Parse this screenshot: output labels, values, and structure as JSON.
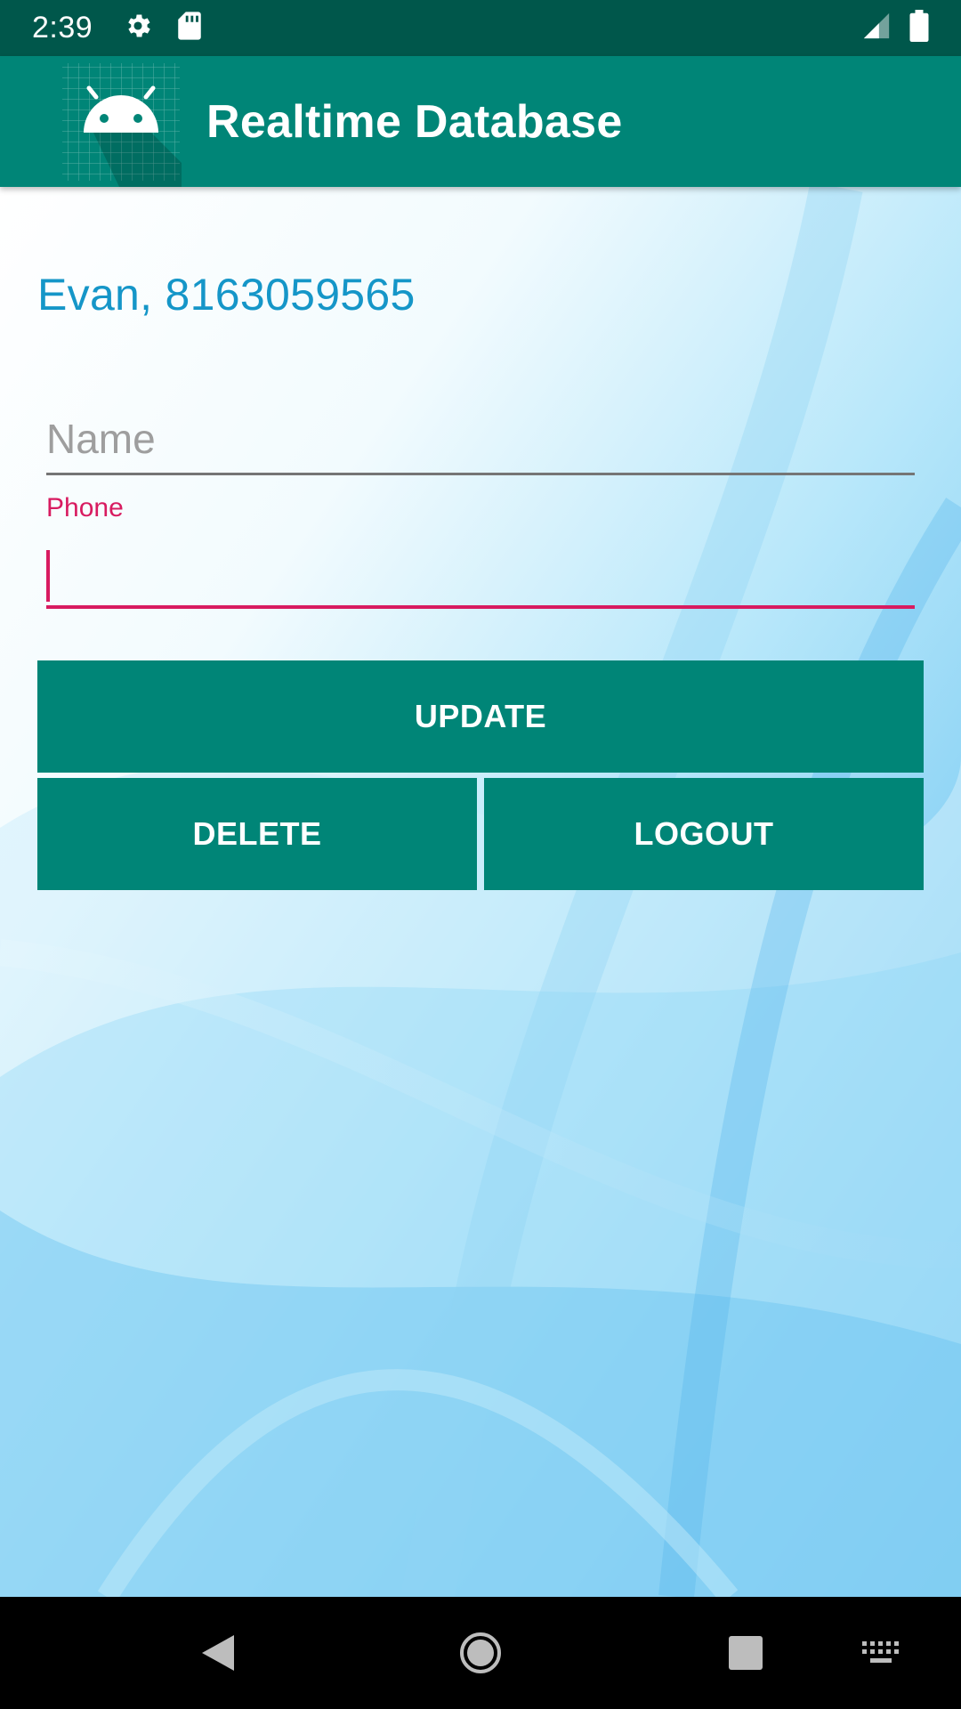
{
  "status_bar": {
    "time": "2:39",
    "icons": [
      "gear-icon",
      "sd-card-icon",
      "signal-icon",
      "battery-icon"
    ]
  },
  "app_bar": {
    "title": "Realtime Database",
    "logo_icon": "android-icon"
  },
  "main": {
    "user_info": "Evan, 8163059565",
    "name_field": {
      "placeholder": "Name",
      "value": ""
    },
    "phone_field": {
      "label": "Phone",
      "value": ""
    },
    "buttons": {
      "update": "UPDATE",
      "delete": "DELETE",
      "logout": "LOGOUT"
    }
  },
  "nav_bar": {
    "icons": [
      "back-icon",
      "home-icon",
      "recents-icon",
      "keyboard-icon"
    ]
  },
  "colors": {
    "status_bar": "#00574B",
    "primary": "#008577",
    "accent": "#D81B60",
    "user_info_text": "#1596C8"
  }
}
